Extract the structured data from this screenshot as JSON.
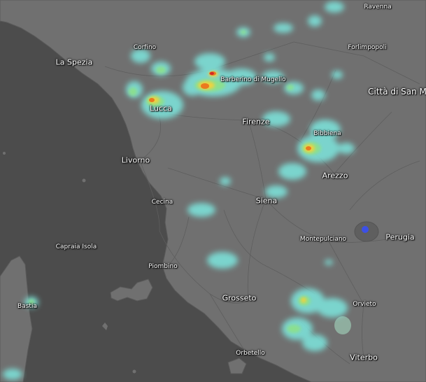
{
  "map": {
    "type": "weather-radar",
    "colors": {
      "sea": "#4c4c4c",
      "land": "#707070",
      "light_rain": "#7de6de",
      "moderate_rain": "#8ce08c",
      "heavy_rain": "#f0d23c",
      "intense_rain": "#eb7a1e",
      "extreme_rain": "#d22828",
      "location_marker": "#3c50e6"
    },
    "places": [
      {
        "id": "ravenna",
        "name": "Ravenna"
      },
      {
        "id": "corfino",
        "name": "Corfino"
      },
      {
        "id": "forlimpopoli",
        "name": "Forlimpopoli"
      },
      {
        "id": "la-spezia",
        "name": "La Spezia"
      },
      {
        "id": "barberino",
        "name": "Barberino di Mugello"
      },
      {
        "id": "citta-di-san",
        "name": "Città di San M"
      },
      {
        "id": "lucca",
        "name": "Lucca"
      },
      {
        "id": "firenze",
        "name": "Firenze"
      },
      {
        "id": "bibbiena",
        "name": "Bibbiena"
      },
      {
        "id": "livorno",
        "name": "Livorno"
      },
      {
        "id": "arezzo",
        "name": "Arezzo"
      },
      {
        "id": "cecina",
        "name": "Cecina"
      },
      {
        "id": "siena",
        "name": "Siena"
      },
      {
        "id": "perugia",
        "name": "Perugia"
      },
      {
        "id": "montepulciano",
        "name": "Montepulciano"
      },
      {
        "id": "capraia",
        "name": "Capraia Isola"
      },
      {
        "id": "piombino",
        "name": "Piombino"
      },
      {
        "id": "bastia",
        "name": "Bastia"
      },
      {
        "id": "grosseto",
        "name": "Grosseto"
      },
      {
        "id": "orvieto",
        "name": "Orvieto"
      },
      {
        "id": "orbetello",
        "name": "Orbetello"
      },
      {
        "id": "viterbo",
        "name": "Viterbo"
      }
    ]
  }
}
